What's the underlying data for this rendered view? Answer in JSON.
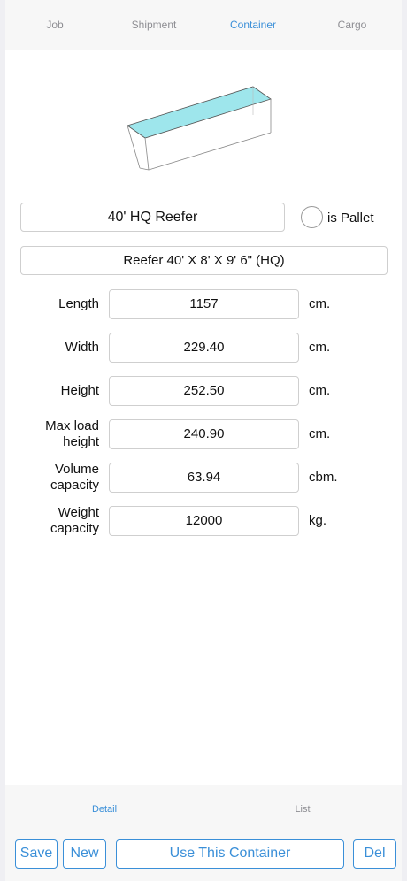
{
  "tabs": {
    "top": [
      {
        "label": "Job",
        "active": false
      },
      {
        "label": "Shipment",
        "active": false
      },
      {
        "label": "Container",
        "active": true
      },
      {
        "label": "Cargo",
        "active": false
      }
    ],
    "bottom": [
      {
        "label": "Detail",
        "active": true
      },
      {
        "label": "List",
        "active": false
      }
    ]
  },
  "container": {
    "name": "40' HQ Reefer",
    "type": "Reefer 40' X 8' X  9' 6\" (HQ)",
    "pallet_label": "is Pallet"
  },
  "dimensions": [
    {
      "label": "Length",
      "value": "1157",
      "unit": "cm."
    },
    {
      "label": "Width",
      "value": "229.40",
      "unit": "cm."
    },
    {
      "label": "Height",
      "value": "252.50",
      "unit": "cm."
    },
    {
      "label": "Max load height",
      "value": "240.90",
      "unit": "cm."
    },
    {
      "label": "Volume capacity",
      "value": "63.94",
      "unit": "cbm."
    },
    {
      "label": "Weight capacity",
      "value": "12000",
      "unit": "kg."
    }
  ],
  "toolbar": {
    "save_label": "Save",
    "new_label": "New",
    "use_label": "Use This Container",
    "del_label": "Del"
  },
  "colors": {
    "accent": "#3a8fd8",
    "container_top": "#9ee6ec"
  },
  "icons": {
    "container_drawing": "container-3d-icon",
    "pallet_toggle": "radio-circle-icon"
  }
}
